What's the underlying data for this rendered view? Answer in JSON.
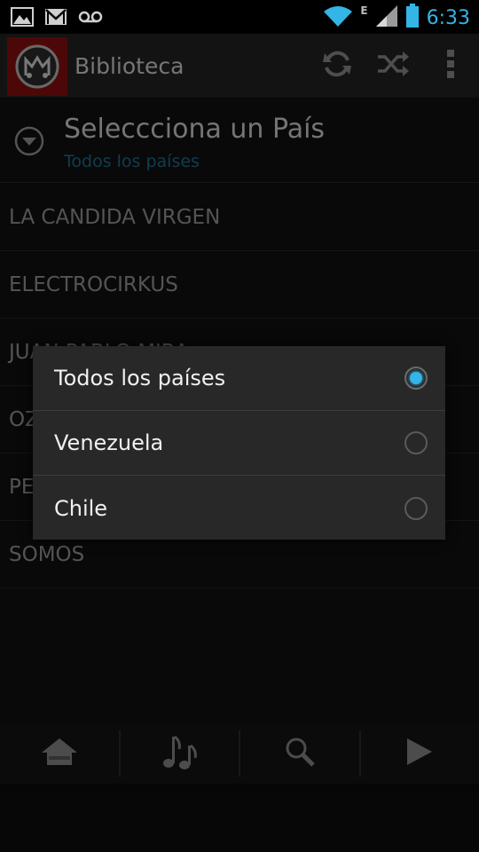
{
  "status_bar": {
    "time": "6:33",
    "network_type": "E",
    "icons": [
      "gallery-icon",
      "gmail-icon",
      "voicemail-icon",
      "wifi-icon",
      "signal-icon",
      "battery-icon"
    ]
  },
  "action_bar": {
    "title": "Biblioteca",
    "actions": [
      "refresh-icon",
      "shuffle-icon",
      "overflow-menu-icon"
    ]
  },
  "selector": {
    "title": "Seleccciona un País",
    "subtitle": "Todos los países"
  },
  "list": {
    "items": [
      "LA CANDIDA VIRGEN",
      "ELECTROCIRKUS",
      "JUAN PABLO MIRA",
      "OZ",
      "PE",
      "SOMOS"
    ]
  },
  "dialog": {
    "options": [
      {
        "label": "Todos los países",
        "checked": true
      },
      {
        "label": "Venezuela",
        "checked": false
      },
      {
        "label": "Chile",
        "checked": false
      }
    ]
  },
  "bottom_nav": {
    "items": [
      "home-icon",
      "music-icon",
      "search-icon",
      "play-icon"
    ]
  },
  "colors": {
    "accent": "#33b5e5",
    "app_icon_bg": "#8a0f0f",
    "action_bar_bg": "#232323",
    "dialog_bg": "#282828"
  }
}
